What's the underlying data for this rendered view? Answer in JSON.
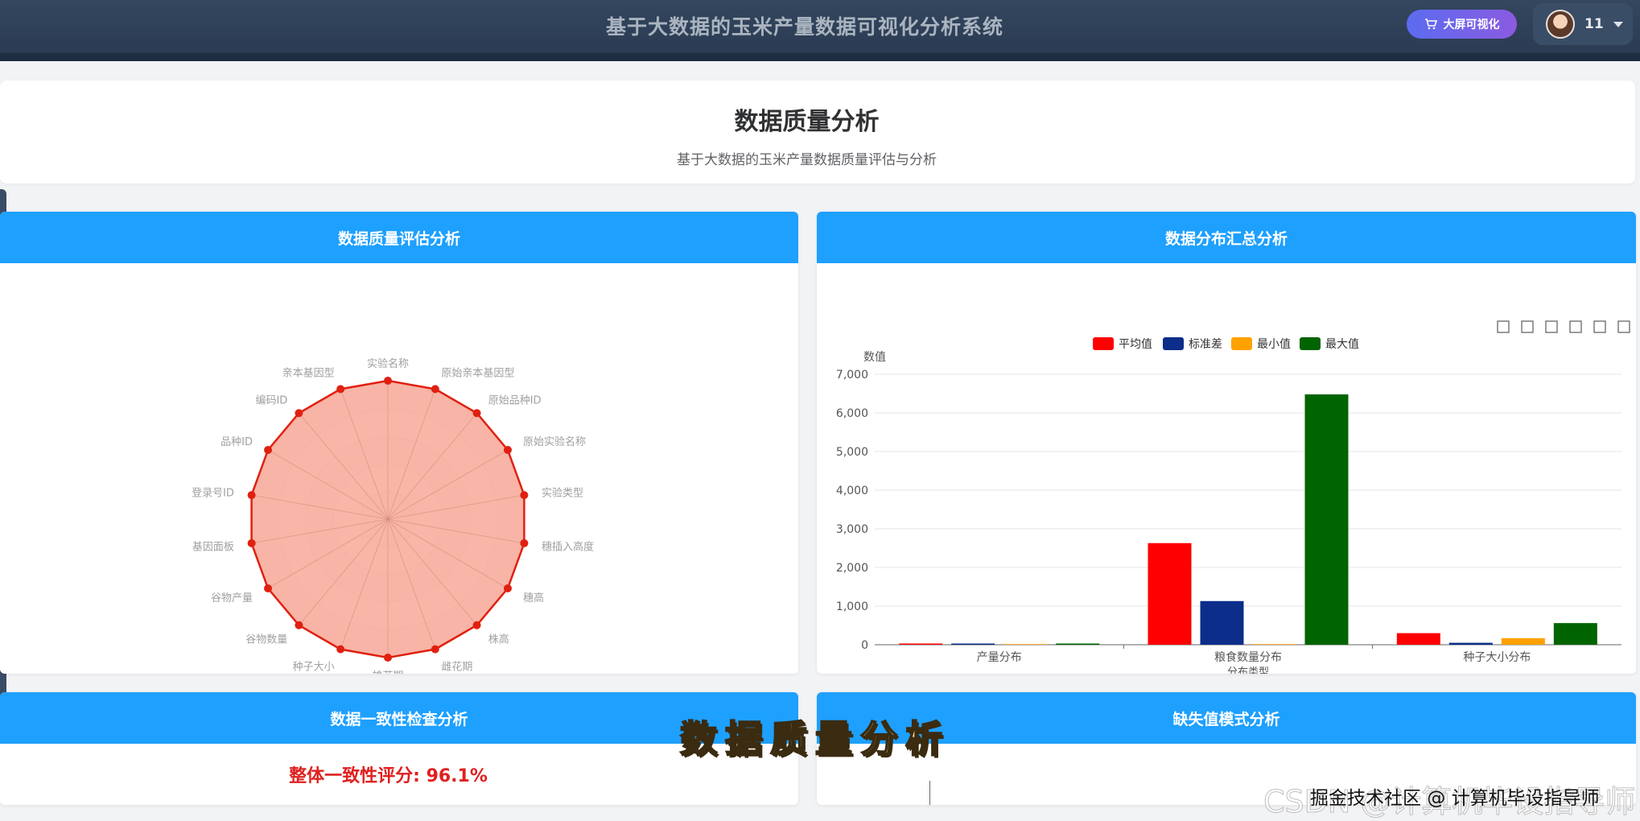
{
  "topbar": {
    "app_title": "基于大数据的玉米产量数据可视化分析系统",
    "big_screen_label": "大屏可视化",
    "user_name": "11"
  },
  "header": {
    "title": "数据质量分析",
    "subtitle": "基于大数据的玉米产量数据质量评估与分析"
  },
  "panels": {
    "quality": {
      "title": "数据质量评估分析"
    },
    "distribution": {
      "title": "数据分布汇总分析"
    },
    "consistency": {
      "title": "数据一致性检查分析",
      "score_text": "整体一致性评分: 96.1%"
    },
    "missing": {
      "title": "缺失值模式分析"
    }
  },
  "overlay": {
    "caption": "数据质量分析",
    "watermark": "CSDN @计算机毕设指导师",
    "credit": "掘金技术社区 @ 计算机毕设指导师"
  },
  "colors": {
    "accent": "#1ea0ff",
    "radar_line": "#e02010",
    "radar_fill": "#f8a898",
    "avg": "#ff0000",
    "std": "#0c2d8a",
    "min": "#ffa100",
    "max": "#006400"
  },
  "toolbox_icons": [
    "crop-icon",
    "crop-reset-icon",
    "restore-icon",
    "download-icon",
    "line-chart-icon",
    "bar-chart-icon"
  ],
  "chart_data": [
    {
      "type": "radar",
      "indicators": [
        "实验名称",
        "原始亲本基因型",
        "原始品种ID",
        "原始实验名称",
        "实验类型",
        "穗插入高度",
        "穗高",
        "株高",
        "雌花期",
        "雄花期",
        "种子大小",
        "谷物数量",
        "谷物产量",
        "基因面板",
        "登录号ID",
        "品种ID",
        "编码ID",
        "亲本基因型"
      ],
      "values": [
        100,
        100,
        100,
        100,
        100,
        100,
        100,
        100,
        100,
        100,
        100,
        100,
        100,
        100,
        100,
        100,
        100,
        100
      ],
      "max": 100
    },
    {
      "type": "bar",
      "categories": [
        "产量分布",
        "粮食数量分布",
        "种子大小分布"
      ],
      "series": [
        {
          "name": "平均值",
          "values": [
            5,
            2630,
            300
          ]
        },
        {
          "name": "标准差",
          "values": [
            3,
            1130,
            50
          ]
        },
        {
          "name": "最小值",
          "values": [
            0,
            0,
            170
          ]
        },
        {
          "name": "最大值",
          "values": [
            15,
            6480,
            560
          ]
        }
      ],
      "ylabel": "数值",
      "xlabel": "分布类型",
      "ylim": [
        0,
        7000
      ],
      "yticks": [
        "0",
        "1,000",
        "2,000",
        "3,000",
        "4,000",
        "5,000",
        "6,000",
        "7,000"
      ],
      "legend": "top-center",
      "grid": true
    }
  ]
}
